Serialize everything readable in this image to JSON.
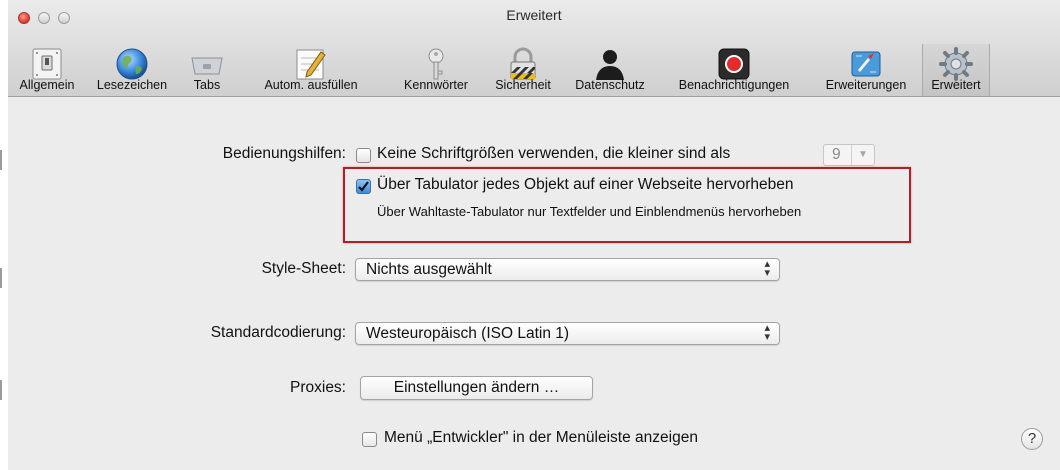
{
  "window": {
    "title": "Erweitert"
  },
  "toolbar": {
    "items": [
      {
        "label": "Allgemein",
        "icon": "switch-icon"
      },
      {
        "label": "Lesezeichen",
        "icon": "globe-icon"
      },
      {
        "label": "Tabs",
        "icon": "tabs-icon"
      },
      {
        "label": "Autom. ausfüllen",
        "icon": "pencil-form-icon"
      },
      {
        "label": "Kennwörter",
        "icon": "key-icon"
      },
      {
        "label": "Sicherheit",
        "icon": "lock-icon"
      },
      {
        "label": "Datenschutz",
        "icon": "person-silhouette-icon"
      },
      {
        "label": "Benachrichtigungen",
        "icon": "record-icon"
      },
      {
        "label": "Erweiterungen",
        "icon": "extensions-icon"
      },
      {
        "label": "Erweitert",
        "icon": "gear-icon",
        "selected": true
      }
    ]
  },
  "accessibility": {
    "label": "Bedienungshilfen:",
    "min_font": {
      "checked": false,
      "label": "Keine Schriftgrößen verwenden, die kleiner sind als",
      "value": "9"
    },
    "tab_highlight": {
      "checked": true,
      "label": "Über Tabulator jedes Objekt auf einer Webseite hervorheben",
      "hint": "Über Wahltaste-Tabulator nur Textfelder und Einblendmenüs hervorheben"
    }
  },
  "stylesheet": {
    "label": "Style-Sheet:",
    "value": "Nichts ausgewählt"
  },
  "encoding": {
    "label": "Standardcodierung:",
    "value": "Westeuropäisch (ISO Latin 1)"
  },
  "proxies": {
    "label": "Proxies:",
    "button": "Einstellungen ändern …"
  },
  "develop_menu": {
    "checked": false,
    "label": "Menü „Entwickler\" in der Menüleiste anzeigen"
  },
  "help": {
    "symbol": "?"
  },
  "colors": {
    "highlight_box": "#b01f24",
    "checkbox_checked": "#3c8be0",
    "record_red": "#e52b2b"
  }
}
